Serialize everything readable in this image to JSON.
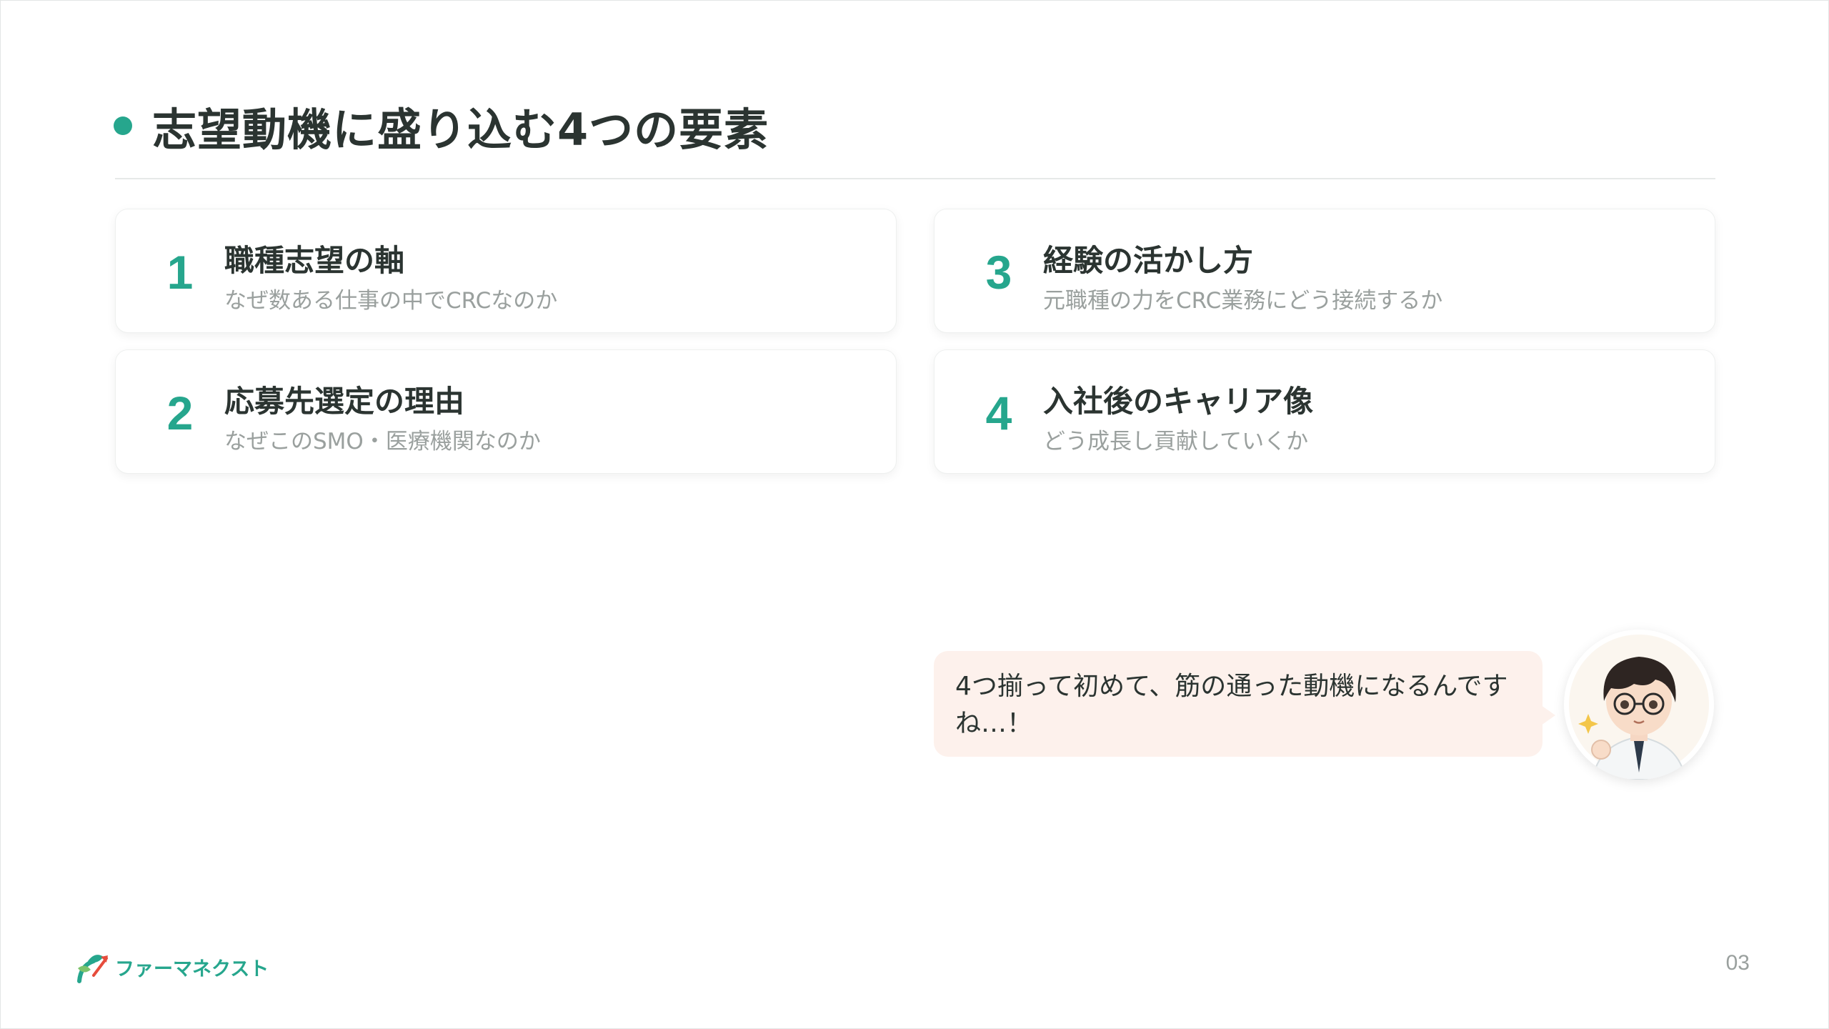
{
  "slide": {
    "title": "志望動機に盛り込む4つの要素",
    "page_number": "03",
    "accent_color": "#26a68d"
  },
  "cards": [
    {
      "number": "1",
      "heading": "職種志望の軸",
      "subtext": "なぜ数ある仕事の中でCRCなのか"
    },
    {
      "number": "2",
      "heading": "応募先選定の理由",
      "subtext": "なぜこのSMO・医療機関なのか"
    },
    {
      "number": "3",
      "heading": "経験の活かし方",
      "subtext": "元職種の力をCRC業務にどう接続するか"
    },
    {
      "number": "4",
      "heading": "入社後のキャリア像",
      "subtext": "どう成長し貢献していくか"
    }
  ],
  "speech": {
    "text_line1": "4つ揃って初めて、筋の通った動機になるんです",
    "text_line2": "ね…！"
  },
  "brand": {
    "logo_text": "ファーマネクスト",
    "logo_icon": "sprout-arrow-icon"
  },
  "character": {
    "icon": "avatar-character-illustration"
  }
}
